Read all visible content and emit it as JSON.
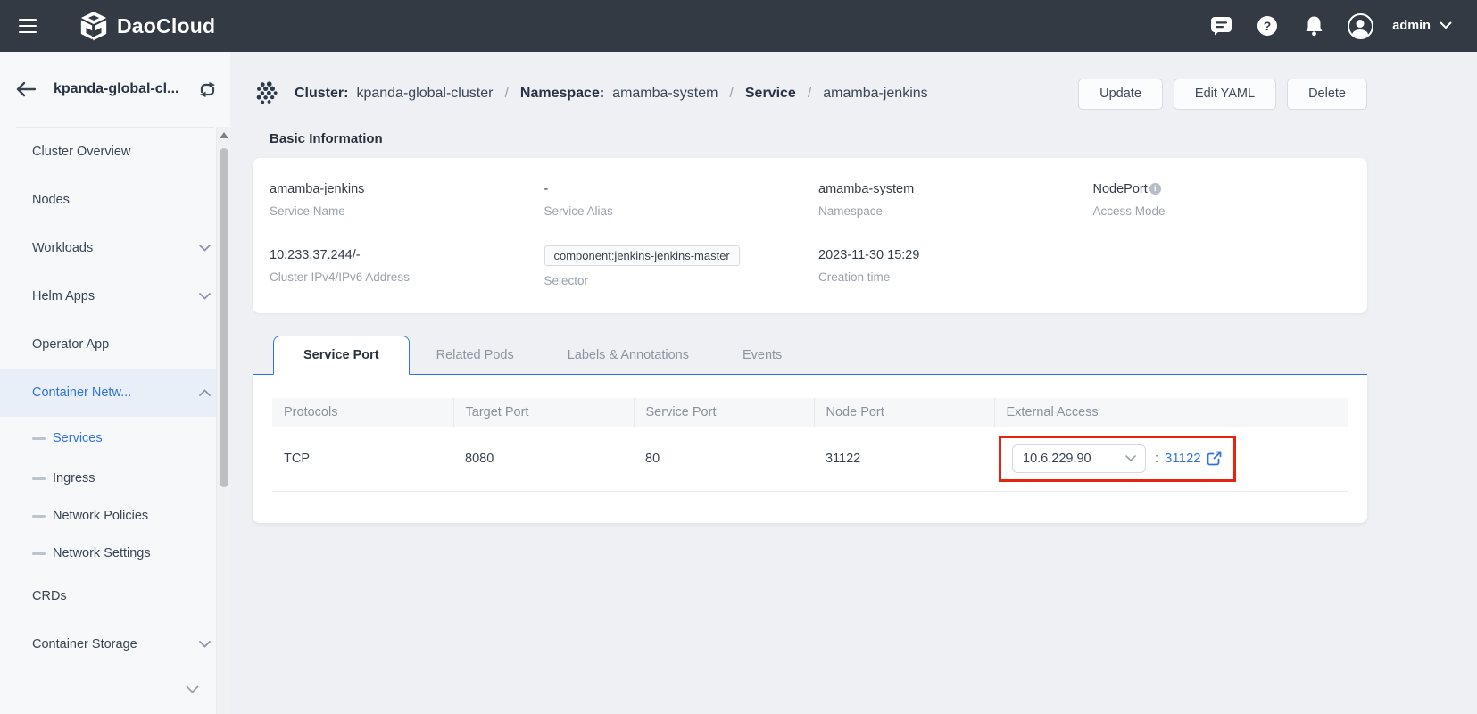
{
  "colors": {
    "accent": "#3273dc",
    "annotation_red": "#e8230f",
    "topbar_bg": "#343a43"
  },
  "topbar": {
    "brand": "DaoCloud",
    "user": "admin",
    "icons": {
      "menu": "hamburger",
      "message": "speech-bubble",
      "help": "question-circle",
      "notifications": "bell",
      "account": "avatar",
      "expand": "chevron-down"
    }
  },
  "sidebar": {
    "title": "kpanda-global-cl...",
    "items": {
      "0": {
        "label": "Cluster Overview"
      },
      "1": {
        "label": "Nodes"
      },
      "2": {
        "label": "Workloads"
      },
      "3": {
        "label": "Helm Apps"
      },
      "4": {
        "label": "Operator App"
      },
      "5": {
        "label": "Container Netw..."
      },
      "6": {
        "label": "Services"
      },
      "7": {
        "label": "Ingress"
      },
      "8": {
        "label": "Network Policies"
      },
      "9": {
        "label": "Network Settings"
      },
      "10": {
        "label": "CRDs"
      },
      "11": {
        "label": "Container Storage"
      }
    }
  },
  "breadcrumb": {
    "cluster_label": "Cluster:",
    "cluster_value": "kpanda-global-cluster",
    "sep": "/",
    "namespace_label": "Namespace:",
    "namespace_value": "amamba-system",
    "service_label": "Service",
    "service_value": "amamba-jenkins"
  },
  "actions": {
    "update": "Update",
    "edit_yaml": "Edit YAML",
    "delete": "Delete"
  },
  "basic_info": {
    "title": "Basic Information",
    "fields": {
      "0": {
        "value": "amamba-jenkins",
        "label": "Service Name"
      },
      "1": {
        "value": "-",
        "label": "Service Alias"
      },
      "2": {
        "value": "amamba-system",
        "label": "Namespace"
      },
      "3": {
        "value": "NodePort",
        "label": "Access Mode",
        "info_icon": "i"
      },
      "4": {
        "value": "10.233.37.244/-",
        "label": "Cluster IPv4/IPv6 Address"
      },
      "5": {
        "value": "component:jenkins-jenkins-master",
        "label": "Selector"
      },
      "6": {
        "value": "2023-11-30 15:29",
        "label": "Creation time"
      }
    }
  },
  "tabs": {
    "0": {
      "label": "Service Port",
      "active": true
    },
    "1": {
      "label": "Related Pods"
    },
    "2": {
      "label": "Labels & Annotations"
    },
    "3": {
      "label": "Events"
    }
  },
  "table": {
    "columns": {
      "0": "Protocols",
      "1": "Target Port",
      "2": "Service Port",
      "3": "Node Port",
      "4": "External Access"
    },
    "row": {
      "protocol": "TCP",
      "target_port": "8080",
      "service_port": "80",
      "node_port": "31122",
      "external_ip": "10.6.229.90",
      "colon": ":",
      "external_port": "31122"
    }
  }
}
